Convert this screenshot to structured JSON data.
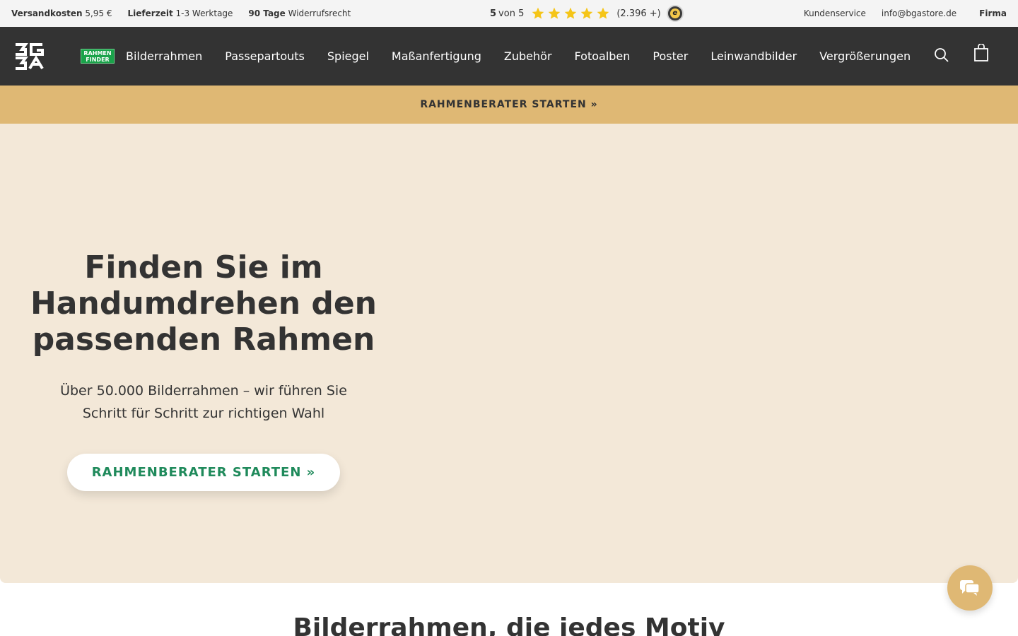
{
  "topbar": {
    "usps": [
      {
        "bold": "Versandkosten",
        "text": "5,95 €"
      },
      {
        "bold": "Lieferzeit",
        "text": "1-3 Werktage"
      },
      {
        "bold": "90 Tage",
        "text": "Widerrufsrecht"
      }
    ],
    "rating": {
      "score": "5",
      "von_label": "von 5",
      "stars": 5,
      "count": "(2.396 +)"
    },
    "links": {
      "service": "Kundenservice",
      "email": "info@bgastore.de",
      "company": "Firma"
    }
  },
  "nav": {
    "finder_badge": "RAHMEN FINDER",
    "items": [
      "Bilderrahmen",
      "Passepartouts",
      "Spiegel",
      "Maßanfertigung",
      "Zubehör",
      "Fotoalben",
      "Poster",
      "Leinwandbilder",
      "Vergrößerungen"
    ]
  },
  "promo": {
    "label": "RAHMENBERATER STARTEN »"
  },
  "hero": {
    "title": "Finden Sie im Handumdrehen den passenden Rahmen",
    "subtitle": "Über 50.000 Bilderrahmen – wir führen Sie Schritt für Schritt zur richtigen Wahl",
    "button": "RAHMENBERATER STARTEN »"
  },
  "section": {
    "title": "Bilderrahmen, die jedes Motiv"
  },
  "colors": {
    "nav_bg": "#333333",
    "promo_bg": "#dfb874",
    "hero_bg": "#f3e8d8",
    "cta_text": "#1f8a5b",
    "star": "#f5c518"
  }
}
